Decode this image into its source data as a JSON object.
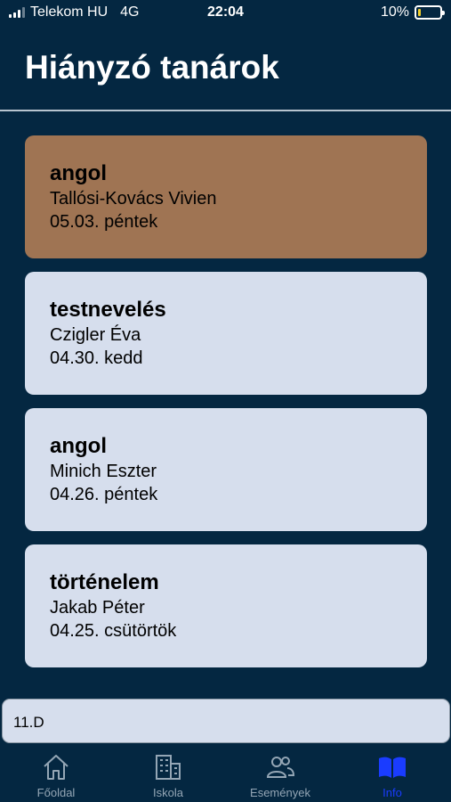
{
  "status_bar": {
    "carrier": "Telekom HU",
    "network": "4G",
    "time": "22:04",
    "battery": "10%"
  },
  "header": {
    "title": "Hiányzó tanárok"
  },
  "absences": [
    {
      "subject": "angol",
      "teacher": "Tallósi-Kovács Vivien",
      "date": "05.03. péntek"
    },
    {
      "subject": "testnevelés",
      "teacher": "Czigler Éva",
      "date": "04.30. kedd"
    },
    {
      "subject": "angol",
      "teacher": "Minich Eszter",
      "date": "04.26. péntek"
    },
    {
      "subject": "történelem",
      "teacher": "Jakab Péter",
      "date": "04.25. csütörtök"
    }
  ],
  "class_selector": {
    "value": "11.D"
  },
  "tabs": [
    {
      "label": "Főoldal",
      "icon": "home-icon"
    },
    {
      "label": "Iskola",
      "icon": "building-icon"
    },
    {
      "label": "Események",
      "icon": "people-icon"
    },
    {
      "label": "Info",
      "icon": "book-icon"
    }
  ],
  "colors": {
    "background": "#042741",
    "card": "#d6deed",
    "card_highlight": "#9f7453",
    "active_tab": "#1a3cff"
  }
}
